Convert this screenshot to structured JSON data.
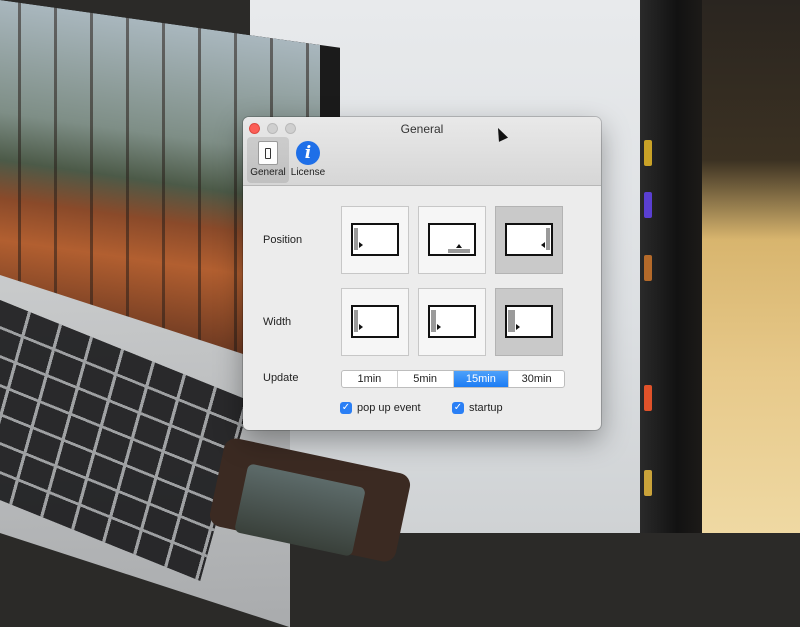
{
  "window": {
    "title": "General",
    "toolbar": [
      {
        "label": "General",
        "icon": "general-icon",
        "active": true
      },
      {
        "label": "License",
        "icon": "info-icon",
        "active": false
      }
    ]
  },
  "position": {
    "label": "Position",
    "options": [
      {
        "name": "left",
        "selected": false
      },
      {
        "name": "bottom",
        "selected": false
      },
      {
        "name": "right",
        "selected": true
      }
    ]
  },
  "width": {
    "label": "Width",
    "options": [
      {
        "name": "narrow",
        "selected": false
      },
      {
        "name": "medium",
        "selected": false
      },
      {
        "name": "wide",
        "selected": true
      }
    ]
  },
  "update": {
    "label": "Update",
    "options": [
      "1min",
      "5min",
      "15min",
      "30min"
    ],
    "selected": "15min"
  },
  "checks": [
    {
      "label": "pop up event",
      "checked": true
    },
    {
      "label": "startup",
      "checked": true
    }
  ],
  "colors": {
    "accent": "#1c7cf4",
    "close": "#fc5f57"
  }
}
